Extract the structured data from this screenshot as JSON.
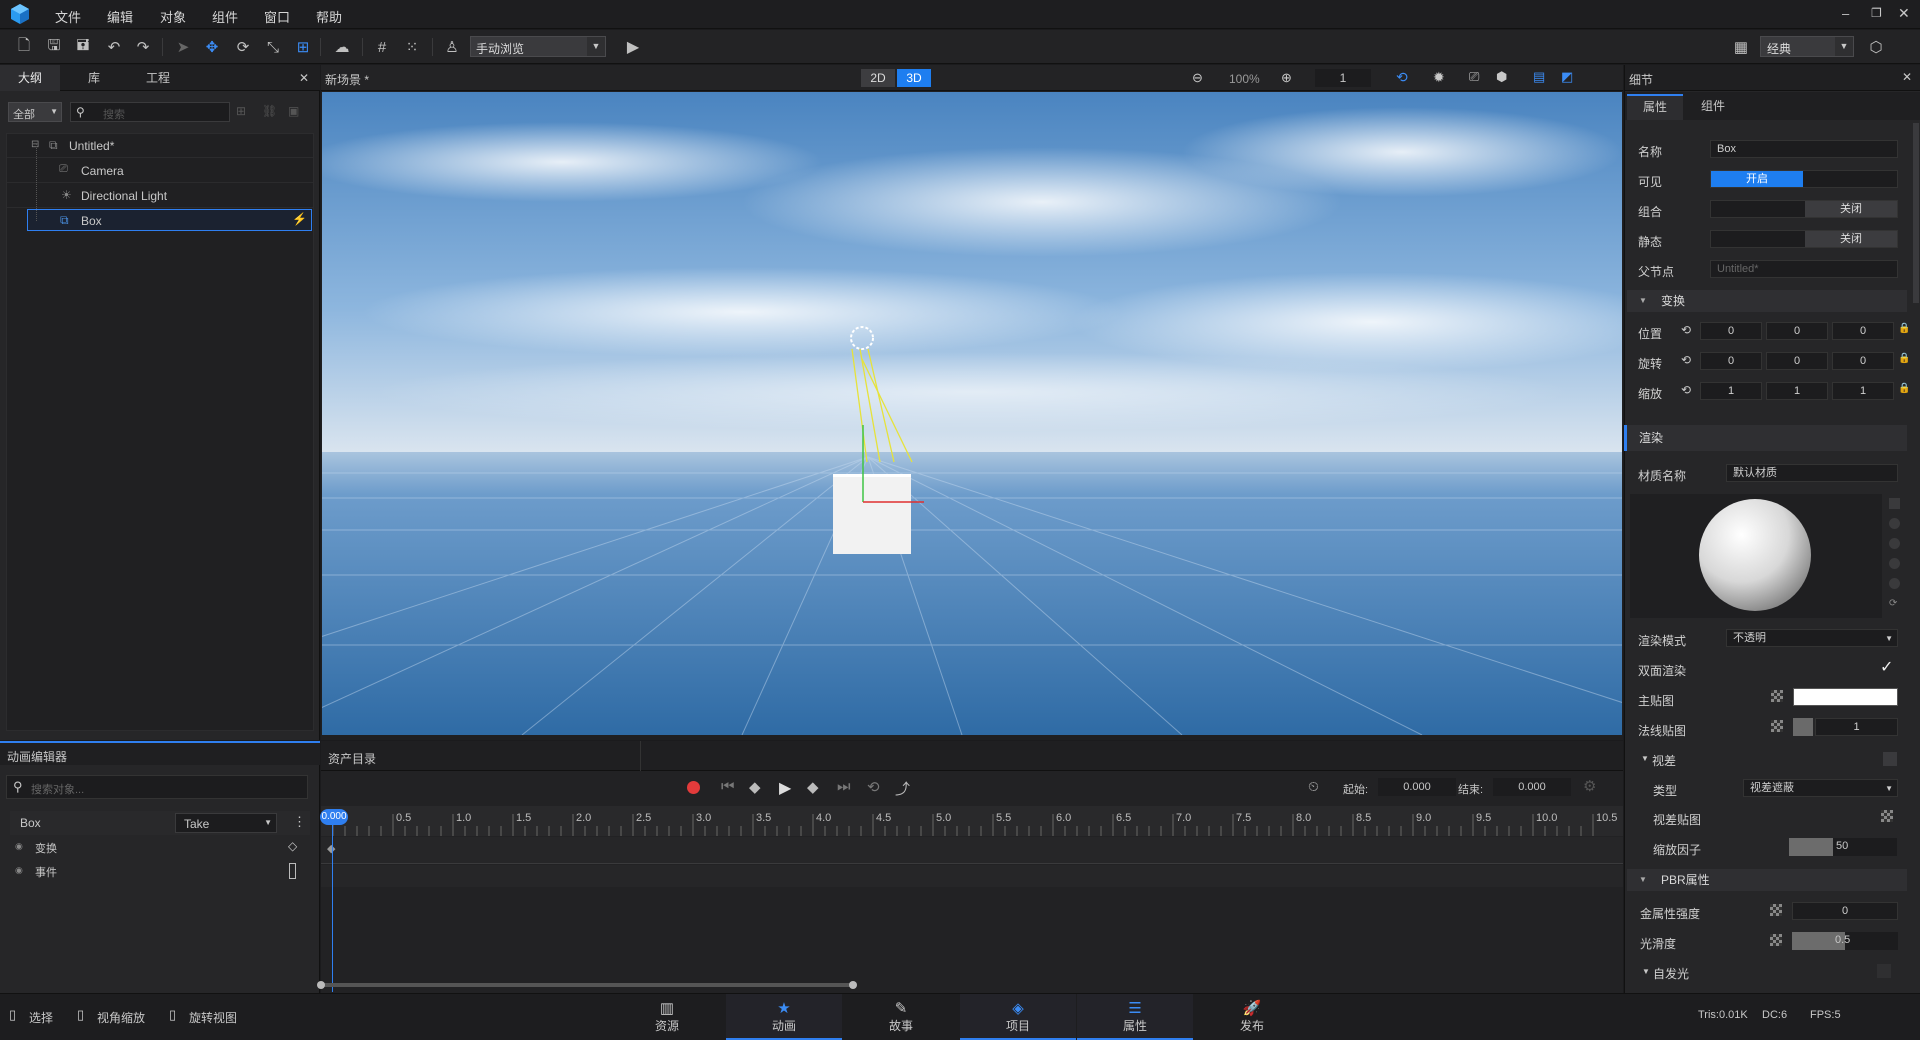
{
  "menu": [
    "文件",
    "编辑",
    "对象",
    "组件",
    "窗口",
    "帮助"
  ],
  "toolbar": {
    "view_mode": "手动浏览",
    "layout": "经典"
  },
  "outline": {
    "tabs": [
      "大纲",
      "库",
      "工程"
    ],
    "filter": "全部",
    "search_placeholder": "搜索",
    "tree": [
      "Untitled*",
      "Camera",
      "Directional Light",
      "Box"
    ]
  },
  "scene": {
    "title": "新场景 *",
    "mode_2d": "2D",
    "mode_3d": "3D",
    "zoom": "100%",
    "count": "1"
  },
  "details": {
    "title": "细节",
    "tabs": [
      "属性",
      "组件"
    ],
    "name_label": "名称",
    "name_value": "Box",
    "visible_label": "可见",
    "visible_value": "开启",
    "group_label": "组合",
    "group_value": "关闭",
    "static_label": "静态",
    "static_value": "关闭",
    "parent_label": "父节点",
    "parent_value": "Untitled*",
    "transform_section": "变换",
    "position_label": "位置",
    "position": [
      "0",
      "0",
      "0"
    ],
    "rotation_label": "旋转",
    "rotation": [
      "0",
      "0",
      "0"
    ],
    "scale_label": "缩放",
    "scale": [
      "1",
      "1",
      "1"
    ],
    "render_section": "渲染",
    "material_label": "材质名称",
    "material_value": "默认材质",
    "render_mode_label": "渲染模式",
    "render_mode_value": "不透明",
    "double_side_label": "双面渲染",
    "main_tex_label": "主贴图",
    "normal_tex_label": "法线贴图",
    "normal_value": "1",
    "parallax_label": "视差",
    "type_label": "类型",
    "type_value": "视差遮蔽",
    "parallax_tex_label": "视差贴图",
    "scale_factor_label": "缩放因子",
    "scale_factor_value": "50",
    "pbr_section": "PBR属性",
    "metal_label": "金属性强度",
    "metal_value": "0",
    "smooth_label": "光滑度",
    "smooth_value": "0.5",
    "emissive_label": "自发光"
  },
  "anim": {
    "title": "动画编辑器",
    "assets_title": "资产目录",
    "search_placeholder": "搜索对象...",
    "object": "Box",
    "take": "Take",
    "tracks": [
      "变换",
      "事件"
    ],
    "start_label": "起始:",
    "start_value": "0.000",
    "end_label": "结束:",
    "end_value": "0.000",
    "playhead": "0.000",
    "ticks": [
      "0.5",
      "1.0",
      "1.5",
      "2.0",
      "2.5",
      "3.0",
      "3.5",
      "4.0",
      "4.5",
      "5.0",
      "5.5",
      "6.0",
      "6.5",
      "7.0",
      "7.5",
      "8.0",
      "8.5",
      "9.0",
      "9.5",
      "10.0",
      "10.5"
    ]
  },
  "bottom": {
    "tools": [
      "选择",
      "视角缩放",
      "旋转视图"
    ],
    "tabs": [
      "资源",
      "动画",
      "故事",
      "项目",
      "属性",
      "发布"
    ],
    "stats": {
      "tris": "Tris:0.01K",
      "dc": "DC:6",
      "fps": "FPS:5"
    }
  },
  "colors": {
    "accent": "#1e7ef0",
    "record": "#e23b3b",
    "panel": "#262628"
  }
}
